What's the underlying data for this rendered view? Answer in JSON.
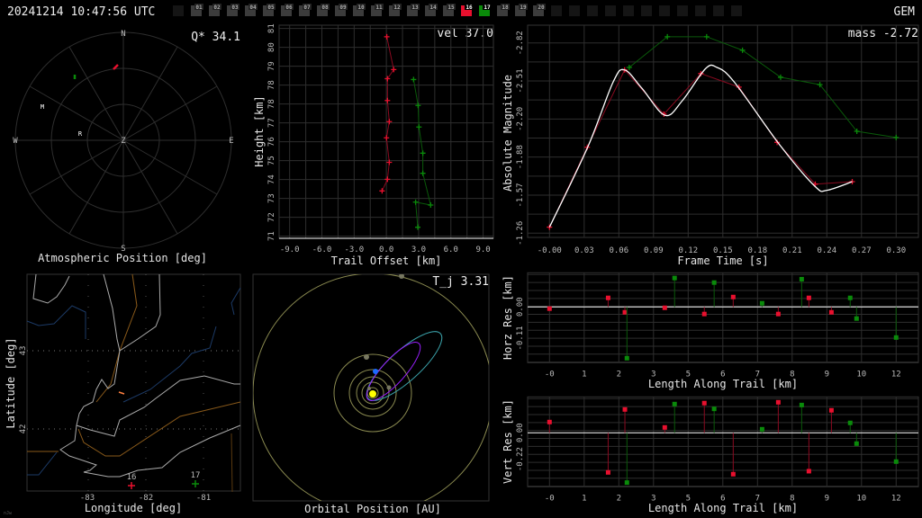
{
  "header": {
    "timestamp": "20241214 10:47:56 UTC",
    "network": "GEM",
    "stations": [
      "",
      "01",
      "02",
      "03",
      "04",
      "05",
      "06",
      "07",
      "08",
      "09",
      "10",
      "11",
      "12",
      "13",
      "14",
      "15",
      "16",
      "17",
      "18",
      "19",
      "20",
      "",
      "",
      "",
      "",
      "",
      "",
      "",
      "",
      "",
      "",
      ""
    ],
    "active": {
      "16": "#e8102e",
      "17": "#0a8a0a"
    }
  },
  "colors": {
    "station_a": "#e8102e",
    "station_b": "#0a8a0a",
    "fit": "#ffffff"
  },
  "atmos": {
    "title": "Atmospheric Position [deg]",
    "metric": "Q* 34.1",
    "labels": {
      "n": "N",
      "s": "S",
      "e": "E",
      "w": "W",
      "z": "Z",
      "m": "M",
      "r": "R"
    }
  },
  "trail": {
    "metric": "vel 37.0",
    "xlabel": "Trail Offset [km]",
    "ylabel": "Height [km]",
    "xticks": [
      "-9.0",
      "-6.0",
      "-3.0",
      "0.0",
      "3.0",
      "6.0",
      "9.0"
    ],
    "yticks": [
      "81",
      "80",
      "79",
      "78",
      "78",
      "77",
      "76",
      "75",
      "74",
      "73",
      "72",
      "71"
    ],
    "series": [
      {
        "name": "16",
        "x": [
          0.04,
          0.68,
          0.1,
          0.1,
          0.27,
          0.01,
          0.27,
          0.1,
          -0.4
        ],
        "y": [
          80.6,
          79.02,
          78.58,
          77.53,
          76.51,
          75.73,
          74.55,
          73.73,
          73.17
        ]
      },
      {
        "name": "17",
        "x": [
          2.53,
          2.95,
          3.03,
          3.39,
          3.39,
          4.12,
          2.72,
          2.92
        ],
        "y": [
          78.54,
          77.29,
          76.25,
          74.99,
          74.02,
          72.49,
          72.63,
          71.42
        ]
      }
    ]
  },
  "magnitude": {
    "metric": "mass -2.72",
    "xlabel": "Frame Time [s]",
    "ylabel": "Absolute Magnitude",
    "xticks": [
      "-0.00",
      "0.03",
      "0.06",
      "0.09",
      "0.12",
      "0.15",
      "0.18",
      "0.21",
      "0.24",
      "0.27",
      "0.30"
    ],
    "yticks": [
      "-2.82",
      "-2.51",
      "-2.20",
      "-1.88",
      "-1.57",
      "-1.26"
    ],
    "series": [
      {
        "name": "16",
        "t": [
          0,
          0.0327,
          0.065,
          0.099,
          0.131,
          0.164,
          0.197,
          0.23,
          0.262
        ],
        "m": [
          -1.32,
          -1.97,
          -2.6,
          -2.24,
          -2.57,
          -2.46,
          -2.01,
          -1.67,
          -1.69
        ]
      },
      {
        "name": "17",
        "t": [
          0.069,
          0.102,
          0.136,
          0.167,
          0.2,
          0.234,
          0.266,
          0.3
        ],
        "m": [
          -2.62,
          -2.87,
          -2.87,
          -2.76,
          -2.54,
          -2.48,
          -2.1,
          -2.05
        ]
      }
    ],
    "fit": {
      "t": [
        0,
        0.033,
        0.055,
        0.065,
        0.08,
        0.1,
        0.115,
        0.135,
        0.145,
        0.16,
        0.2,
        0.23,
        0.24,
        0.262
      ],
      "m": [
        -1.32,
        -1.97,
        -2.5,
        -2.6,
        -2.45,
        -2.23,
        -2.35,
        -2.61,
        -2.62,
        -2.5,
        -1.98,
        -1.65,
        -1.62,
        -1.69
      ]
    }
  },
  "map": {
    "xlabel": "Longitude [deg]",
    "ylabel": "Latitude [deg]",
    "xticks": [
      "-83",
      "-82",
      "-81"
    ],
    "yticks": [
      "43",
      "42"
    ],
    "stations": [
      {
        "label": "16"
      },
      {
        "label": "17"
      }
    ],
    "watermark": "nJw"
  },
  "orbit": {
    "title": "Orbital Position [AU]",
    "metric": "T_j 3.31"
  },
  "horz_res": {
    "xlabel": "Length Along Trail [km]",
    "ylabel": "Horz Res [km]",
    "xticks": [
      "-0",
      "1",
      "2",
      "3",
      "5",
      "6",
      "7",
      "8",
      "9",
      "10",
      "12"
    ],
    "yticks": [
      "0.00",
      "-0.11"
    ],
    "series": [
      {
        "name": "16",
        "x": [
          0,
          2.03,
          2.61,
          3.99,
          5.36,
          6.36,
          7.92,
          8.98,
          9.76
        ],
        "r": [
          -0.006,
          0.032,
          -0.019,
          -0.003,
          -0.025,
          0.035,
          -0.025,
          0.032,
          -0.019
        ]
      },
      {
        "name": "17",
        "x": [
          2.68,
          4.33,
          5.7,
          7.36,
          8.73,
          10.41,
          10.63,
          12.0
        ],
        "r": [
          -0.181,
          0.102,
          0.086,
          0.013,
          0.098,
          0.032,
          -0.041,
          -0.108
        ]
      }
    ]
  },
  "vert_res": {
    "xlabel": "Length Along Trail [km]",
    "ylabel": "Vert Res [km]",
    "xticks": [
      "-0",
      "1",
      "2",
      "3",
      "5",
      "6",
      "7",
      "8",
      "9",
      "10",
      "12"
    ],
    "yticks": [
      "0.00",
      "-0.22"
    ],
    "series": [
      {
        "name": "16",
        "x": [
          0,
          2.03,
          2.61,
          3.99,
          5.36,
          6.36,
          7.92,
          8.98,
          9.76
        ],
        "r": [
          0.09,
          -0.33,
          0.195,
          0.045,
          0.248,
          -0.345,
          0.255,
          -0.32,
          0.188
        ]
      },
      {
        "name": "17",
        "x": [
          2.68,
          4.33,
          5.7,
          7.36,
          8.73,
          10.41,
          10.63,
          12.0
        ],
        "r": [
          -0.415,
          0.24,
          0.2,
          0.03,
          0.232,
          0.083,
          -0.09,
          -0.24
        ]
      }
    ]
  }
}
